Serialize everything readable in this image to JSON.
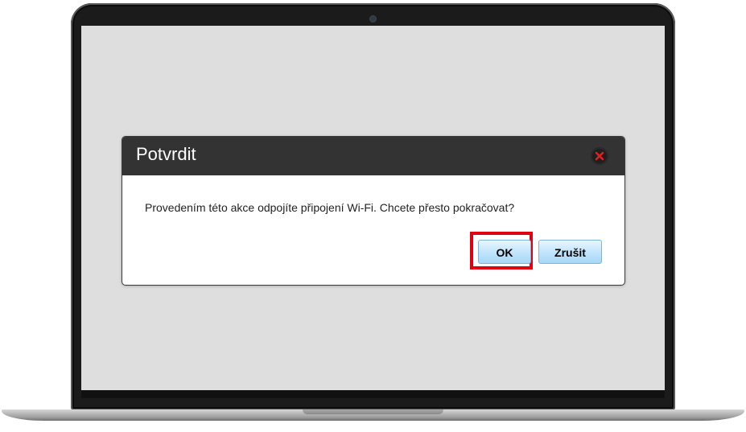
{
  "dialog": {
    "title": "Potvrdit",
    "message": "Provedením této akce odpojíte připojení Wi-Fi. Chcete přesto pokračovat?",
    "ok_label": "OK",
    "cancel_label": "Zrušit",
    "close_icon": "close-icon"
  },
  "colors": {
    "screen_background": "#dedede",
    "header_background": "#333333",
    "highlight": "#e00010",
    "button_gradient_top": "#e8f6ff",
    "button_gradient_bottom": "#a6d8f6",
    "close_x": "#e02020"
  }
}
